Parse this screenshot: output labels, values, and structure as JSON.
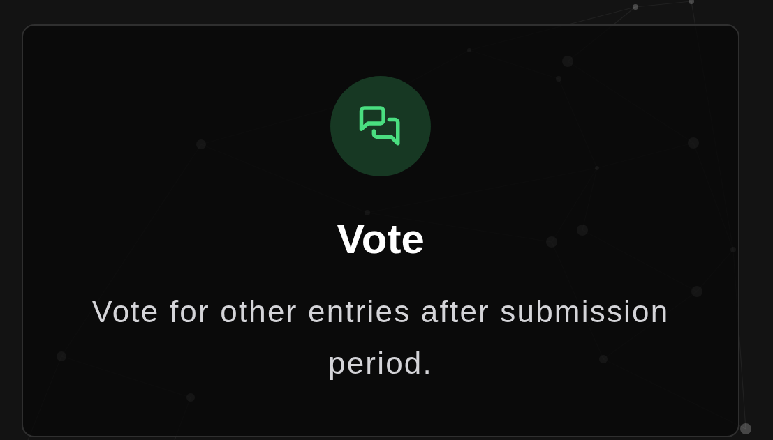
{
  "card": {
    "title": "Vote",
    "description": "Vote for other entries after submission period."
  }
}
